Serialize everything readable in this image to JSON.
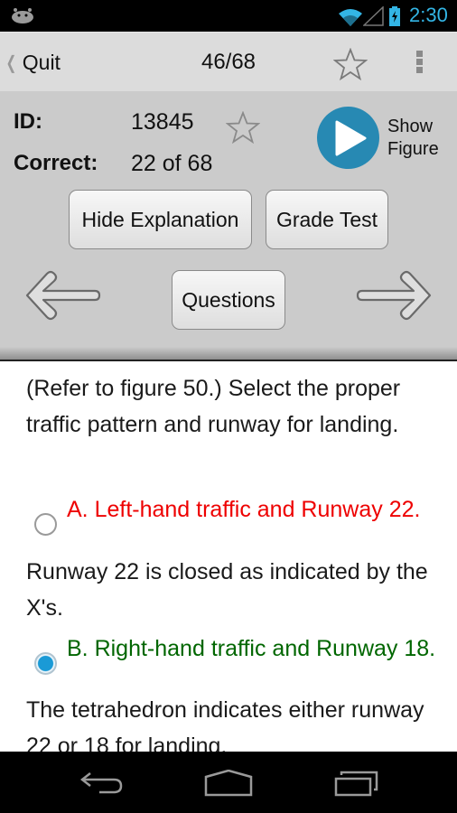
{
  "status_bar": {
    "time": "2:30",
    "icons": [
      "android-debug-icon",
      "wifi-icon",
      "signal-icon",
      "battery-charging-icon"
    ]
  },
  "action_bar": {
    "quit_label": "Quit",
    "counter": "46/68",
    "icons": [
      "back-chevron-icon",
      "star-outline-icon",
      "overflow-menu-icon"
    ]
  },
  "info": {
    "id_label": "ID:",
    "id_value": "13845",
    "correct_label": "Correct:",
    "correct_value": "22 of 68",
    "show_figure_line1": "Show",
    "show_figure_line2": "Figure"
  },
  "buttons": {
    "hide_explanation": "Hide Explanation",
    "grade_test": "Grade Test",
    "questions": "Questions"
  },
  "question": {
    "text": "(Refer to figure 50.) Select the proper traffic pattern and runway for landing.",
    "options": [
      {
        "label": "A. Left-hand traffic and Runway 22.",
        "selected": false,
        "color": "#ee0000",
        "explanation": "Runway 22 is closed as indicated by the X's."
      },
      {
        "label": "B. Right-hand traffic and Runway 18.",
        "selected": true,
        "color": "#006600",
        "explanation": "The tetrahedron indicates either runway 22 or 18 for landing."
      }
    ]
  },
  "colors": {
    "accent": "#33b5e5",
    "play_button": "#2789b3",
    "wrong": "#ee0000",
    "correct": "#006600"
  },
  "nav_bar": {
    "icons": [
      "back-icon",
      "home-icon",
      "recent-apps-icon"
    ]
  }
}
